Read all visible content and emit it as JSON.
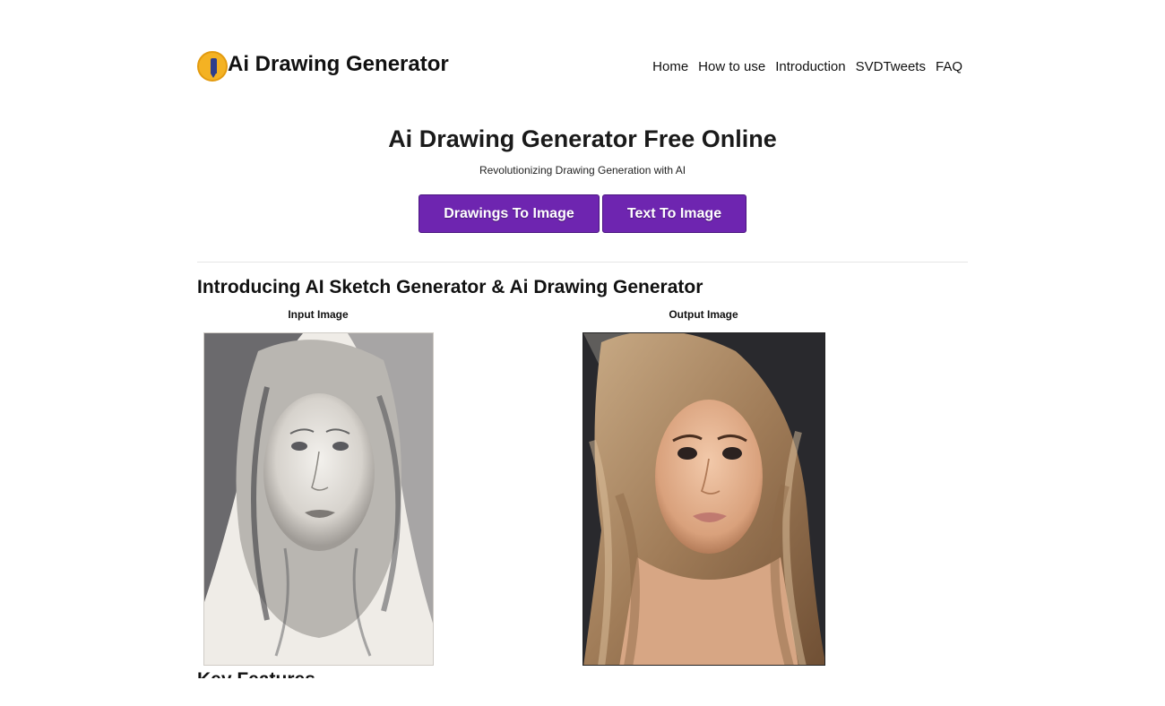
{
  "header": {
    "brand": "Ai Drawing Generator",
    "logo_icon": "pencil-icon",
    "nav": [
      {
        "label": "Home"
      },
      {
        "label": "How to use"
      },
      {
        "label": "Introduction"
      },
      {
        "label": "SVDTweets"
      },
      {
        "label": "FAQ"
      }
    ]
  },
  "hero": {
    "title": "Ai Drawing Generator Free Online",
    "subtitle": "Revolutionizing Drawing Generation with AI",
    "buttons": [
      {
        "label": "Drawings To Image"
      },
      {
        "label": "Text To Image"
      }
    ]
  },
  "section": {
    "title": "Introducing AI Sketch Generator & Ai Drawing Generator",
    "input_caption": "Input Image",
    "output_caption": "Output Image",
    "next_title": "Key Features"
  },
  "colors": {
    "accent": "#6e25b0",
    "logo": "#f4b223"
  }
}
